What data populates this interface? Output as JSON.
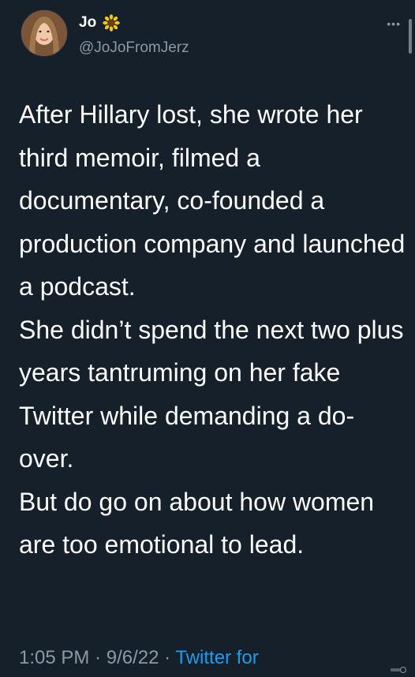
{
  "author": {
    "name": "Jo",
    "handle": "@JoJoFromJerz"
  },
  "tweet": {
    "paragraphs": [
      "After Hillary lost, she wrote her third memoir, filmed a documentary, co-founded a production company and launched a podcast.",
      "She didn’t spend the next two plus years tantruming on her fake Twitter while demanding a do-over.",
      "But do go on about how women are too emotional to lead."
    ]
  },
  "meta": {
    "time": "1:05 PM",
    "date": "9/6/22",
    "source": "Twitter for",
    "separator": " · "
  },
  "icons": {
    "more": "more-icon",
    "flower": "sunflower-icon"
  },
  "colors": {
    "background": "#15202b",
    "secondary_text": "#8b98a5",
    "link": "#1d9bf0",
    "primary_text": "#ffffff"
  }
}
